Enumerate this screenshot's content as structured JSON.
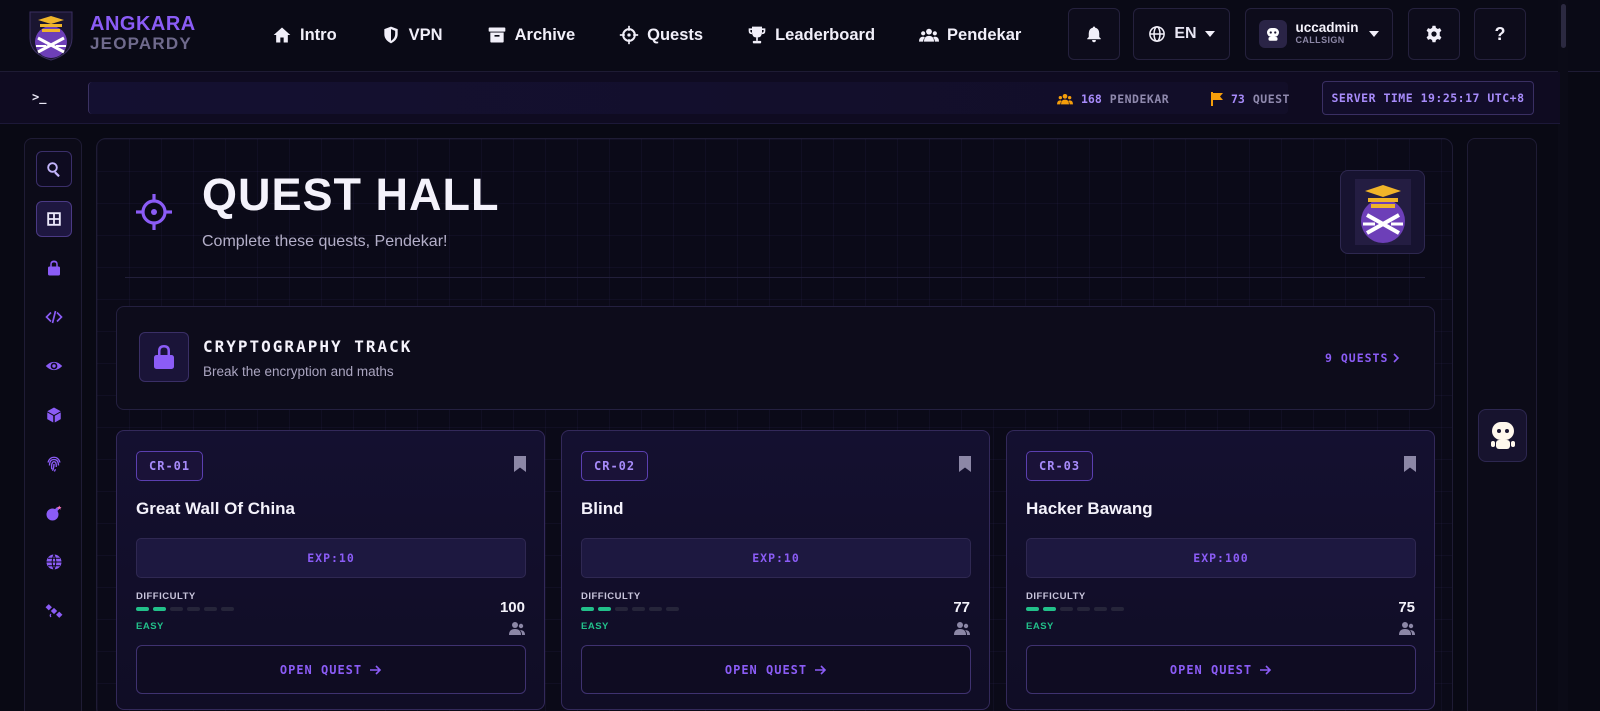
{
  "brand": {
    "line1": "ANGKARA",
    "line2": "JEOPARDY"
  },
  "nav": {
    "items": [
      {
        "label": "Intro",
        "icon": "home-icon"
      },
      {
        "label": "VPN",
        "icon": "shield-icon"
      },
      {
        "label": "Archive",
        "icon": "archive-icon"
      },
      {
        "label": "Quests",
        "icon": "crosshair-icon"
      },
      {
        "label": "Leaderboard",
        "icon": "trophy-icon"
      },
      {
        "label": "Pendekar",
        "icon": "users-icon"
      }
    ]
  },
  "topbar": {
    "language": "EN",
    "user": {
      "name": "uccadmin",
      "role": "CALLSIGN"
    },
    "help": "?"
  },
  "ticker": {
    "prompt": ">_",
    "pendekar_count": "168",
    "pendekar_label": "PENDEKAR",
    "quest_count": "73",
    "quest_label": "QUEST",
    "server_time": "SERVER TIME 19:25:17 UTC+8"
  },
  "sidebar": {
    "items": [
      "search-icon",
      "grid-icon",
      "lock-icon",
      "code-icon",
      "eye-icon",
      "cube-icon",
      "fingerprint-icon",
      "bomb-icon",
      "globe-icon",
      "satellite-icon"
    ]
  },
  "hero": {
    "title": "QUEST HALL",
    "subtitle": "Complete these quests, Pendekar!"
  },
  "track": {
    "title": "CRYPTOGRAPHY TRACK",
    "subtitle": "Break the encryption and maths",
    "count": "9 QUESTS"
  },
  "cards": [
    {
      "code": "CR-01",
      "title": "Great Wall Of China",
      "exp": "EXP:10",
      "difficulty_label": "DIFFICULTY",
      "difficulty": "EASY",
      "difficulty_level": 2,
      "difficulty_max": 6,
      "solves": "100",
      "button": "OPEN QUEST"
    },
    {
      "code": "CR-02",
      "title": "Blind",
      "exp": "EXP:10",
      "difficulty_label": "DIFFICULTY",
      "difficulty": "EASY",
      "difficulty_level": 2,
      "difficulty_max": 6,
      "solves": "77",
      "button": "OPEN QUEST"
    },
    {
      "code": "CR-03",
      "title": "Hacker Bawang",
      "exp": "EXP:100",
      "difficulty_label": "DIFFICULTY",
      "difficulty": "EASY",
      "difficulty_level": 2,
      "difficulty_max": 6,
      "solves": "75",
      "button": "OPEN QUEST"
    }
  ],
  "colors": {
    "accent": "#8b5cf6",
    "easy": "#22c08a",
    "background": "#090914",
    "gold": "#f0b429"
  }
}
